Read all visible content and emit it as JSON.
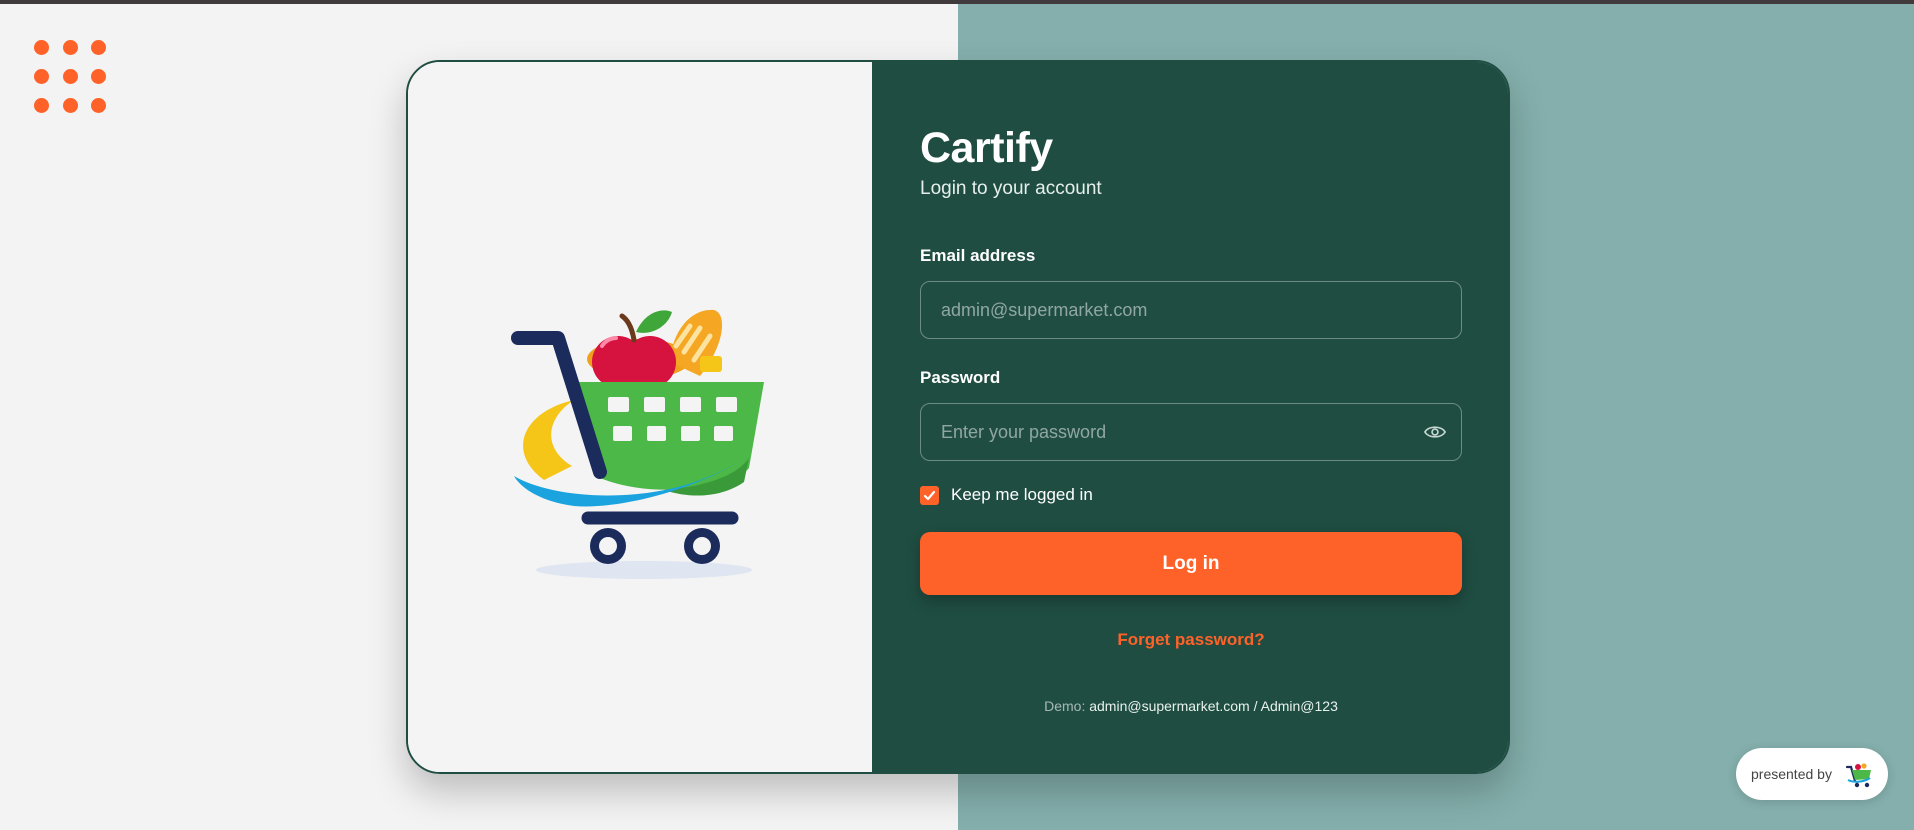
{
  "colors": {
    "accent": "#ff6228",
    "panel": "#1f4d42",
    "bg_right": "#84afac",
    "page_bg": "#f3f3f3"
  },
  "menu_icon": "dots-grid-icon",
  "card": {
    "illustration": "shopping-cart-logo",
    "brand": "Cartify",
    "subtitle": "Login to your account",
    "email": {
      "label": "Email address",
      "value": "",
      "placeholder": "admin@supermarket.com"
    },
    "password": {
      "label": "Password",
      "value": "",
      "placeholder": "Enter your password",
      "toggle_icon": "eye-icon"
    },
    "remember": {
      "label": "Keep me logged in",
      "checked": true
    },
    "login_button": "Log in",
    "forgot_link": "Forget password?",
    "demo": {
      "prefix": "Demo:",
      "credentials": "admin@supermarket.com / Admin@123"
    }
  },
  "badge": {
    "text": "presented by",
    "icon": "cart-logo-icon"
  }
}
